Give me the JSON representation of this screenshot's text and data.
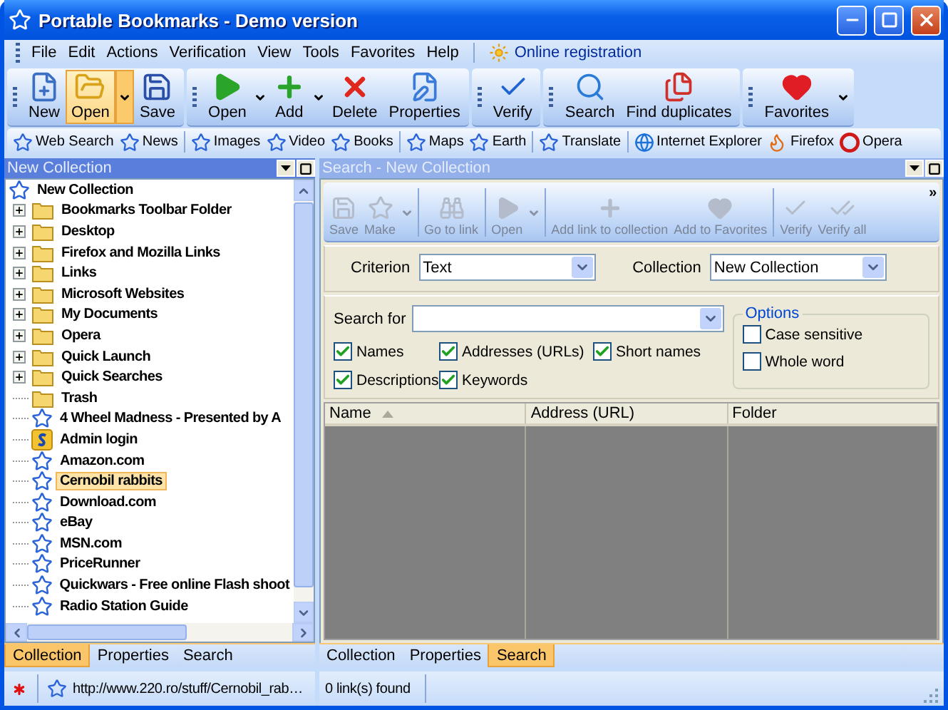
{
  "window": {
    "title": "Portable Bookmarks - Demo version"
  },
  "menu": [
    "File",
    "Edit",
    "Actions",
    "Verification",
    "View",
    "Tools",
    "Favorites",
    "Help"
  ],
  "registration": {
    "label": "Online registration"
  },
  "toolbar": [
    [
      {
        "label": "New",
        "kind": "new",
        "dropdown": false,
        "hovered": false
      },
      {
        "label": "Open",
        "kind": "open-folder",
        "dropdown": true,
        "hovered": true
      },
      {
        "label": "Save",
        "kind": "save",
        "dropdown": false,
        "hovered": false
      }
    ],
    [
      {
        "label": "Open",
        "kind": "play",
        "dropdown": true,
        "hovered": false
      },
      {
        "label": "Add",
        "kind": "add",
        "dropdown": true,
        "hovered": false
      },
      {
        "label": "Delete",
        "kind": "delete",
        "dropdown": false,
        "hovered": false
      },
      {
        "label": "Properties",
        "kind": "properties",
        "dropdown": false,
        "hovered": false
      }
    ],
    [
      {
        "label": "Verify",
        "kind": "verify",
        "dropdown": false,
        "hovered": false
      }
    ],
    [
      {
        "label": "Search",
        "kind": "search",
        "dropdown": false,
        "hovered": false
      },
      {
        "label": "Find duplicates",
        "kind": "duplicates",
        "dropdown": false,
        "hovered": false
      }
    ],
    [
      {
        "label": "Favorites",
        "kind": "favorites",
        "dropdown": true,
        "hovered": false
      }
    ]
  ],
  "links": [
    [
      {
        "label": "Web Search",
        "kind": "star"
      },
      {
        "label": "News",
        "kind": "star"
      }
    ],
    [
      {
        "label": "Images",
        "kind": "star"
      },
      {
        "label": "Video",
        "kind": "star"
      },
      {
        "label": "Books",
        "kind": "star"
      }
    ],
    [
      {
        "label": "Maps",
        "kind": "star"
      },
      {
        "label": "Earth",
        "kind": "star"
      }
    ],
    [
      {
        "label": "Translate",
        "kind": "star"
      }
    ],
    [
      {
        "label": "Internet Explorer",
        "kind": "ie"
      },
      {
        "label": "Firefox",
        "kind": "firefox"
      },
      {
        "label": "Opera",
        "kind": "opera"
      }
    ]
  ],
  "collection_pane": {
    "title": "New Collection",
    "tree": {
      "label": "New Collection",
      "kind": "bookmark",
      "selected": false,
      "children": [
        {
          "label": "Bookmarks Toolbar Folder",
          "kind": "folder",
          "expanded": false,
          "selected": false
        },
        {
          "label": "Desktop",
          "kind": "folder",
          "expanded": false,
          "selected": false
        },
        {
          "label": "Firefox and Mozilla Links",
          "kind": "folder",
          "expanded": false,
          "selected": false
        },
        {
          "label": "Links",
          "kind": "folder",
          "expanded": false,
          "selected": false
        },
        {
          "label": "Microsoft Websites",
          "kind": "folder",
          "expanded": false,
          "selected": false
        },
        {
          "label": "My Documents",
          "kind": "folder",
          "expanded": false,
          "selected": false
        },
        {
          "label": "Opera",
          "kind": "folder",
          "expanded": false,
          "selected": false
        },
        {
          "label": "Quick Launch",
          "kind": "folder",
          "expanded": false,
          "selected": false
        },
        {
          "label": "Quick Searches",
          "kind": "folder",
          "expanded": false,
          "selected": false
        },
        {
          "label": "Trash",
          "kind": "empty-folder",
          "selected": false
        },
        {
          "label": "4 Wheel Madness - Presented by A",
          "kind": "bookmark",
          "selected": false
        },
        {
          "label": "Admin login",
          "kind": "script",
          "selected": false
        },
        {
          "label": "Amazon.com",
          "kind": "bookmark",
          "selected": false
        },
        {
          "label": "Cernobil rabbits",
          "kind": "bookmark",
          "selected": true
        },
        {
          "label": "Download.com",
          "kind": "bookmark",
          "selected": false
        },
        {
          "label": "eBay",
          "kind": "bookmark",
          "selected": false
        },
        {
          "label": "MSN.com",
          "kind": "bookmark",
          "selected": false
        },
        {
          "label": "PriceRunner",
          "kind": "bookmark",
          "selected": false
        },
        {
          "label": "Quickwars - Free online Flash shoot",
          "kind": "bookmark",
          "selected": false
        },
        {
          "label": "Radio Station Guide",
          "kind": "bookmark",
          "selected": false
        }
      ]
    },
    "tabs": [
      {
        "label": "Collection",
        "selected": true
      },
      {
        "label": "Properties",
        "selected": false
      },
      {
        "label": "Search",
        "selected": false
      }
    ],
    "status": "http://www.220.ro/stuff/Cernobil_rab…"
  },
  "search_pane": {
    "title": "Search - New Collection",
    "toolbar": [
      [
        {
          "label": "Save",
          "kind": "save",
          "dropdown": false,
          "disabled": true
        },
        {
          "label": "Make",
          "kind": "make",
          "dropdown": true,
          "disabled": true
        }
      ],
      [
        {
          "label": "Go to link",
          "kind": "goto",
          "dropdown": false,
          "disabled": true
        }
      ],
      [
        {
          "label": "Open",
          "kind": "play",
          "dropdown": true,
          "disabled": true
        }
      ],
      [
        {
          "label": "Add link to collection",
          "kind": "add",
          "dropdown": false,
          "disabled": true
        },
        {
          "label": "Add to Favorites",
          "kind": "favorites",
          "dropdown": false,
          "disabled": true
        }
      ],
      [
        {
          "label": "Verify",
          "kind": "verify",
          "dropdown": false,
          "disabled": true
        },
        {
          "label": "Verify all",
          "kind": "verify-all",
          "dropdown": false,
          "disabled": true
        }
      ]
    ],
    "overflow": "»",
    "criterion": {
      "label": "Criterion",
      "value": "Text"
    },
    "collection": {
      "label": "Collection",
      "value": "New Collection"
    },
    "search_for": {
      "label": "Search for"
    },
    "fields": [
      [
        {
          "label": "Names",
          "checked": true
        },
        {
          "label": "Addresses (URLs)",
          "checked": true
        },
        {
          "label": "Short names",
          "checked": true
        }
      ],
      [
        {
          "label": "Descriptions",
          "checked": true
        },
        {
          "label": "Keywords",
          "checked": true
        }
      ]
    ],
    "options": {
      "title": "Options",
      "items": [
        {
          "label": "Case sensitive",
          "checked": false
        },
        {
          "label": "Whole word",
          "checked": false
        }
      ]
    },
    "table": {
      "columns": [
        {
          "label": "Name",
          "sorted": true
        },
        {
          "label": "Address (URL)",
          "sorted": false
        },
        {
          "label": "Folder",
          "sorted": false
        }
      ]
    },
    "tabs": [
      {
        "label": "Collection",
        "selected": false
      },
      {
        "label": "Properties",
        "selected": false
      },
      {
        "label": "Search",
        "selected": true
      }
    ],
    "status": "0 link(s) found"
  }
}
